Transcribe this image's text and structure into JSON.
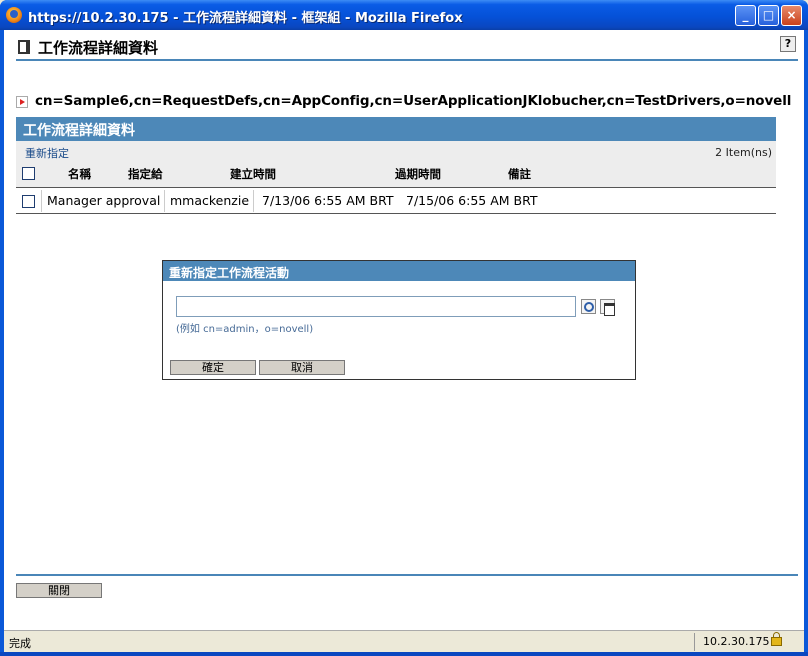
{
  "window": {
    "title": "https://10.2.30.175 - 工作流程詳細資料 - 框架組 - Mozilla Firefox",
    "minimize_glyph": "_",
    "maximize_glyph": "□",
    "close_glyph": "×"
  },
  "page": {
    "title": "工作流程詳細資料",
    "help_label": "?",
    "dn": "cn=Sample6,cn=RequestDefs,cn=AppConfig,cn=UserApplicationJKlobucher,cn=TestDrivers,o=novell"
  },
  "panel": {
    "header": "工作流程詳細資料",
    "reassign_link": "重新指定",
    "item_count": "2 Item(ns)",
    "columns": [
      "名稱",
      "指定給",
      "建立時間",
      "過期時間",
      "備註"
    ],
    "rows": [
      {
        "name": "Manager approval",
        "assigned_to": "mmackenzie",
        "created": "7/13/06 6:55 AM BRT",
        "expires": "7/15/06 6:55 AM BRT",
        "notes": ""
      }
    ]
  },
  "dialog": {
    "title": "重新指定工作流程活動",
    "input_value": "",
    "hint": "(例如 cn=admin，o=novell)",
    "ok_label": "確定",
    "cancel_label": "取消"
  },
  "footer": {
    "close_label": "關閉"
  },
  "statusbar": {
    "text": "完成",
    "host": "10.2.30.175"
  },
  "icons": {
    "app": "firefox-icon",
    "page": "workflow-icon",
    "dn": "expand-arrow-icon",
    "search": "magnifier-icon",
    "browse": "object-selector-icon",
    "lock": "padlock-icon"
  },
  "colors": {
    "titlebar": "#0a5ce6",
    "panel_header": "#4d88b8",
    "link": "#1a4b8a"
  }
}
